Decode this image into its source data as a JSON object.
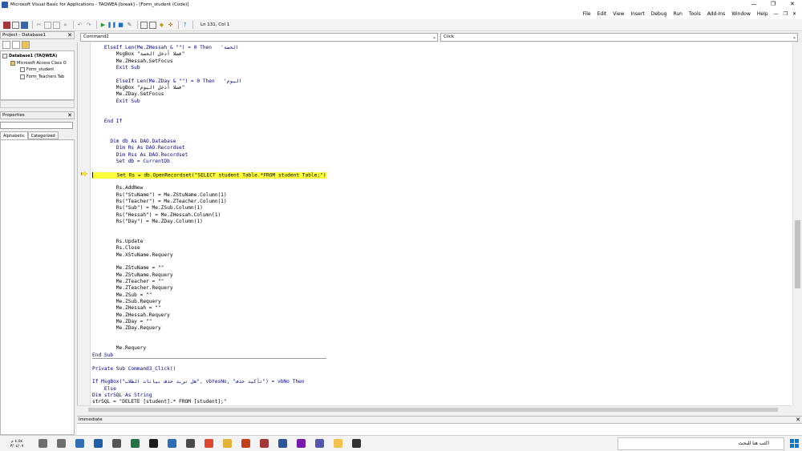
{
  "window": {
    "title": "Microsoft Visual Basic for Applications - TAQWEA [break] - [Form_student (Code)]",
    "controls": [
      "—",
      "❐",
      "✕"
    ]
  },
  "menu": [
    "File",
    "Edit",
    "View",
    "Insert",
    "Debug",
    "Run",
    "Tools",
    "Add-Ins",
    "Window",
    "Help"
  ],
  "menu_window_controls": [
    "—",
    "❐",
    "✕"
  ],
  "toolbar": {
    "position": "Ln 131, Col 1"
  },
  "project": {
    "title": "Project - Database1",
    "tree": [
      {
        "label": "Database1 (TAQWEA)",
        "level": 0
      },
      {
        "label": "Microsoft Access Class O",
        "level": 1
      },
      {
        "label": "Form_student",
        "level": 2
      },
      {
        "label": "Form_Teachers Tab",
        "level": 2
      }
    ]
  },
  "properties": {
    "title": "Properties",
    "tabs": [
      "Alphabetic",
      "Categorized"
    ]
  },
  "editor": {
    "object_combo": "Command2",
    "proc_combo": "Click",
    "lines": [
      {
        "t": "    ElseIf Len(Me.ZHessah & \"\") = 0 Then   'الحصة",
        "c": "kw"
      },
      {
        "t": "        MsgBox \"فضلا أدخل الحصة\""
      },
      {
        "t": "        Me.ZHessah.SetFocus"
      },
      {
        "t": "        Exit Sub",
        "c": "kw"
      },
      {
        "t": ""
      },
      {
        "t": "        ElseIf Len(Me.ZDay & \"\") = 0 Then   'اليوم",
        "c": "kw"
      },
      {
        "t": "        MsgBox \"فضلا أدخل اليوم\""
      },
      {
        "t": "        Me.ZDay.SetFocus"
      },
      {
        "t": "        Exit Sub",
        "c": "kw"
      },
      {
        "t": ""
      },
      {
        "t": ""
      },
      {
        "t": "    End If",
        "c": "kw"
      },
      {
        "t": ""
      },
      {
        "t": ""
      },
      {
        "t": "      Dim db As DAO.Database",
        "c": "kw"
      },
      {
        "t": "        Dim Rs As DAO.Recordset",
        "c": "kw"
      },
      {
        "t": "        Dim Rss As DAO.Recordset",
        "c": "kw"
      },
      {
        "t": "        Set db = CurrentDb",
        "c": "kw"
      },
      {
        "t": ""
      },
      {
        "t": "        Set Rs = db.OpenRecordset(\"SELECT student Table.*FROM student Table;\")",
        "c": "hl",
        "caret": true
      },
      {
        "t": ""
      },
      {
        "t": "        Rs.AddNew"
      },
      {
        "t": "        Rs(\"StuName\") = Me.ZStuName.Column(1)"
      },
      {
        "t": "        Rs(\"Teacher\") = Me.ZTeacher.Column(1)"
      },
      {
        "t": "        Rs(\"Sub\") = Me.ZSub.Column(1)"
      },
      {
        "t": "        Rs(\"Hessah\") = Me.ZHessah.Column(1)"
      },
      {
        "t": "        Rs(\"Day\") = Me.ZDay.Column(1)"
      },
      {
        "t": ""
      },
      {
        "t": ""
      },
      {
        "t": "        Rs.Update"
      },
      {
        "t": "        Rs.Close"
      },
      {
        "t": "        Me.XStuName.Requery"
      },
      {
        "t": ""
      },
      {
        "t": "        Me.ZStuName = \"\""
      },
      {
        "t": "        Me.ZStuName.Requery"
      },
      {
        "t": "        Me.ZTeacher = \"\""
      },
      {
        "t": "        Me.ZTeacher.Requery"
      },
      {
        "t": "        Me.ZSub = \"\""
      },
      {
        "t": "        Me.ZSub.Requery"
      },
      {
        "t": "        Me.ZHessah = \"\""
      },
      {
        "t": "        Me.ZHessah.Requery"
      },
      {
        "t": "        Me.ZDay = \"\""
      },
      {
        "t": "        Me.ZDay.Requery"
      },
      {
        "t": ""
      },
      {
        "t": ""
      },
      {
        "t": "        Me.Requery"
      },
      {
        "t": "End Sub",
        "c": "kw sep"
      },
      {
        "t": ""
      },
      {
        "t": "Private Sub Command3_Click()",
        "c": "kw"
      },
      {
        "t": ""
      },
      {
        "t": "If MsgBox(\"هل تريد حذف بيانات الطلاب\", vbYesNo, \"تأكيد حذف\") = vbNo Then",
        "c": "kw"
      },
      {
        "t": "    Else",
        "c": "kw"
      },
      {
        "t": "Dim strSQL As String",
        "c": "kw"
      },
      {
        "t": "strSQL = \"DELETE [student].* FROM [student];\""
      }
    ]
  },
  "immediate": {
    "title": "Immediate"
  },
  "taskbar": {
    "time": "٤:٥٤ م",
    "date": "٣/٠٤/٠٧",
    "search_placeholder": "اكتب هنا للبحث",
    "icons": [
      "sound-icon",
      "network-icon",
      "edge-icon",
      "files-icon",
      "calculator-icon",
      "excel-icon",
      "cortana-icon",
      "mail-icon",
      "store-icon",
      "chrome-icon",
      "folder-icon",
      "powerpoint-icon",
      "access-icon",
      "word-icon",
      "onenote-icon",
      "teams-icon",
      "explorer-icon",
      "task-view-icon"
    ],
    "icon_colors": [
      "#6e6e6e",
      "#6e6e6e",
      "#2f6fb5",
      "#1f5fa8",
      "#555555",
      "#217346",
      "#1b1b1b",
      "#2c6fb7",
      "#4a4a4a",
      "#e0452f",
      "#e3b238",
      "#c43e1c",
      "#a4373a",
      "#2b579a",
      "#7719aa",
      "#5558af",
      "#f2c14e",
      "#333333"
    ]
  }
}
